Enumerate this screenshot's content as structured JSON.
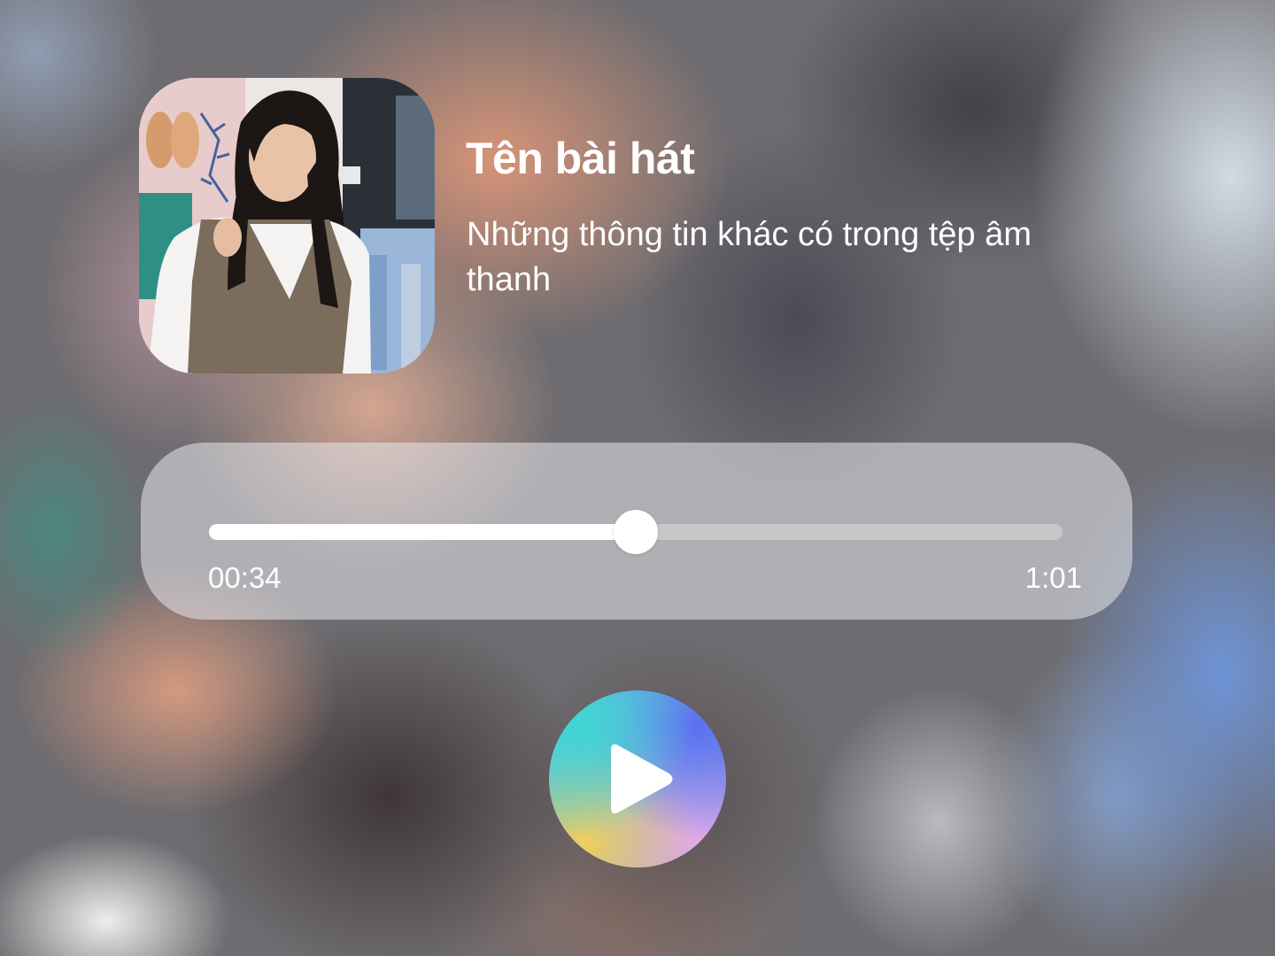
{
  "player": {
    "title": "Tên bài hát",
    "info": "Những thông tin khác có trong tệp âm thanh",
    "cover_icon": "album-cover-photo"
  },
  "progress": {
    "current_time": "00:34",
    "total_time": "1:01",
    "fraction": 0.5
  },
  "controls": {
    "play_icon": "play-icon"
  },
  "colors": {
    "progress_fill": "#ffffff",
    "progress_track": "#cdcdcd",
    "play_gradient": [
      "#3fd6d2",
      "#5a6ff0",
      "#f0cf5c",
      "#e4a8e8"
    ]
  }
}
